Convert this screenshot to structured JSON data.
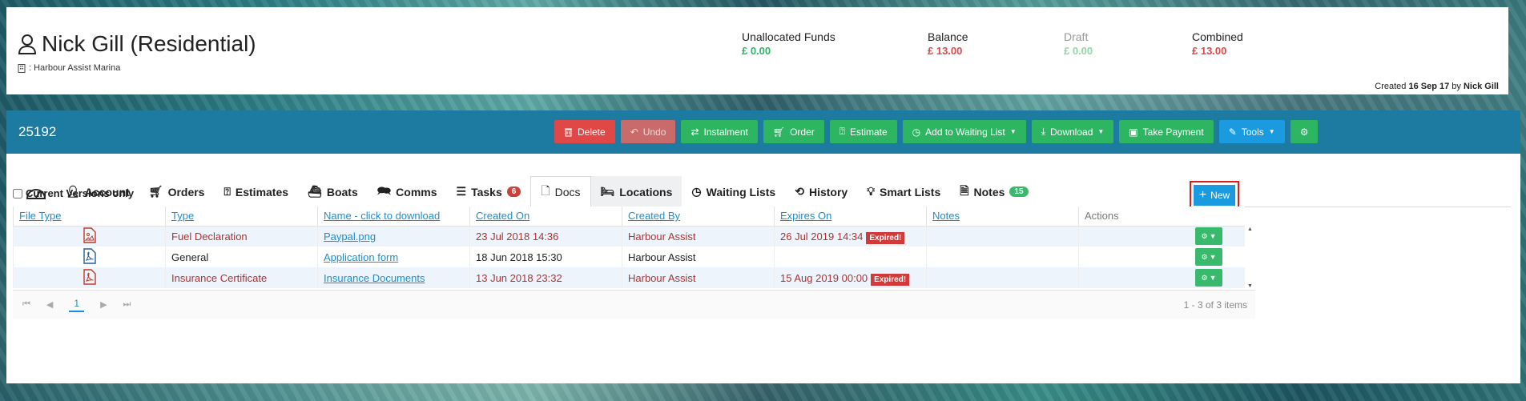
{
  "customer": {
    "name": "Nick Gill (Residential)",
    "site": ": Harbour Assist Marina"
  },
  "finance": {
    "unallocated_label": "Unallocated Funds",
    "unallocated_value": "£ 0.00",
    "balance_label": "Balance",
    "balance_value": "£ 13.00",
    "draft_label": "Draft",
    "draft_value": "£ 0.00",
    "combined_label": "Combined",
    "combined_value": "£ 13.00",
    "colors": {
      "green": "#2db562",
      "red": "#e04848",
      "draft_green": "#8fd8a8"
    }
  },
  "created": {
    "prefix": "Created",
    "date": "16 Sep 17",
    "by_word": "by",
    "by": "Nick Gill"
  },
  "account_number": "25192",
  "toolbar": {
    "delete": "Delete",
    "undo": "Undo",
    "instalment": "Instalment",
    "order": "Order",
    "estimate": "Estimate",
    "waiting_list": "Add to Waiting List",
    "download": "Download",
    "take_payment": "Take Payment",
    "tools": "Tools"
  },
  "tabs": [
    {
      "label": ""
    },
    {
      "label": "Account"
    },
    {
      "label": "Orders"
    },
    {
      "label": "Estimates"
    },
    {
      "label": "Boats"
    },
    {
      "label": "Comms"
    },
    {
      "label": "Tasks",
      "badge": "6"
    },
    {
      "label": "Docs"
    },
    {
      "label": "Locations"
    },
    {
      "label": "Waiting Lists"
    },
    {
      "label": "History"
    },
    {
      "label": "Smart Lists"
    },
    {
      "label": "Notes",
      "badge": "15"
    }
  ],
  "filter": {
    "current_versions": "Current Versions only"
  },
  "new_button": "New",
  "table": {
    "headers": [
      "File Type",
      "Type",
      "Name - click to download",
      "Created On",
      "Created By",
      "Expires On",
      "Notes",
      "Actions"
    ],
    "rows": [
      {
        "type": "Fuel Declaration",
        "name": "Paypal.png",
        "created_on": "23 Jul 2018 14:36",
        "created_by": "Harbour Assist",
        "expires_on": "26 Jul 2019 14:34",
        "expired": "Expired!",
        "icon": "image-file-icon"
      },
      {
        "type": "General",
        "name": "Application form",
        "created_on": "18 Jun 2018 15:30",
        "created_by": "Harbour Assist",
        "expires_on": "",
        "expired": "",
        "icon": "pdf-file-icon"
      },
      {
        "type": "Insurance Certificate",
        "name": "Insurance Documents",
        "created_on": "13 Jun 2018 23:32",
        "created_by": "Harbour Assist",
        "expires_on": "15 Aug 2019 00:00",
        "expired": "Expired!",
        "icon": "pdf-file-icon"
      }
    ]
  },
  "pager": {
    "page": "1",
    "info": "1 - 3 of 3 items"
  }
}
